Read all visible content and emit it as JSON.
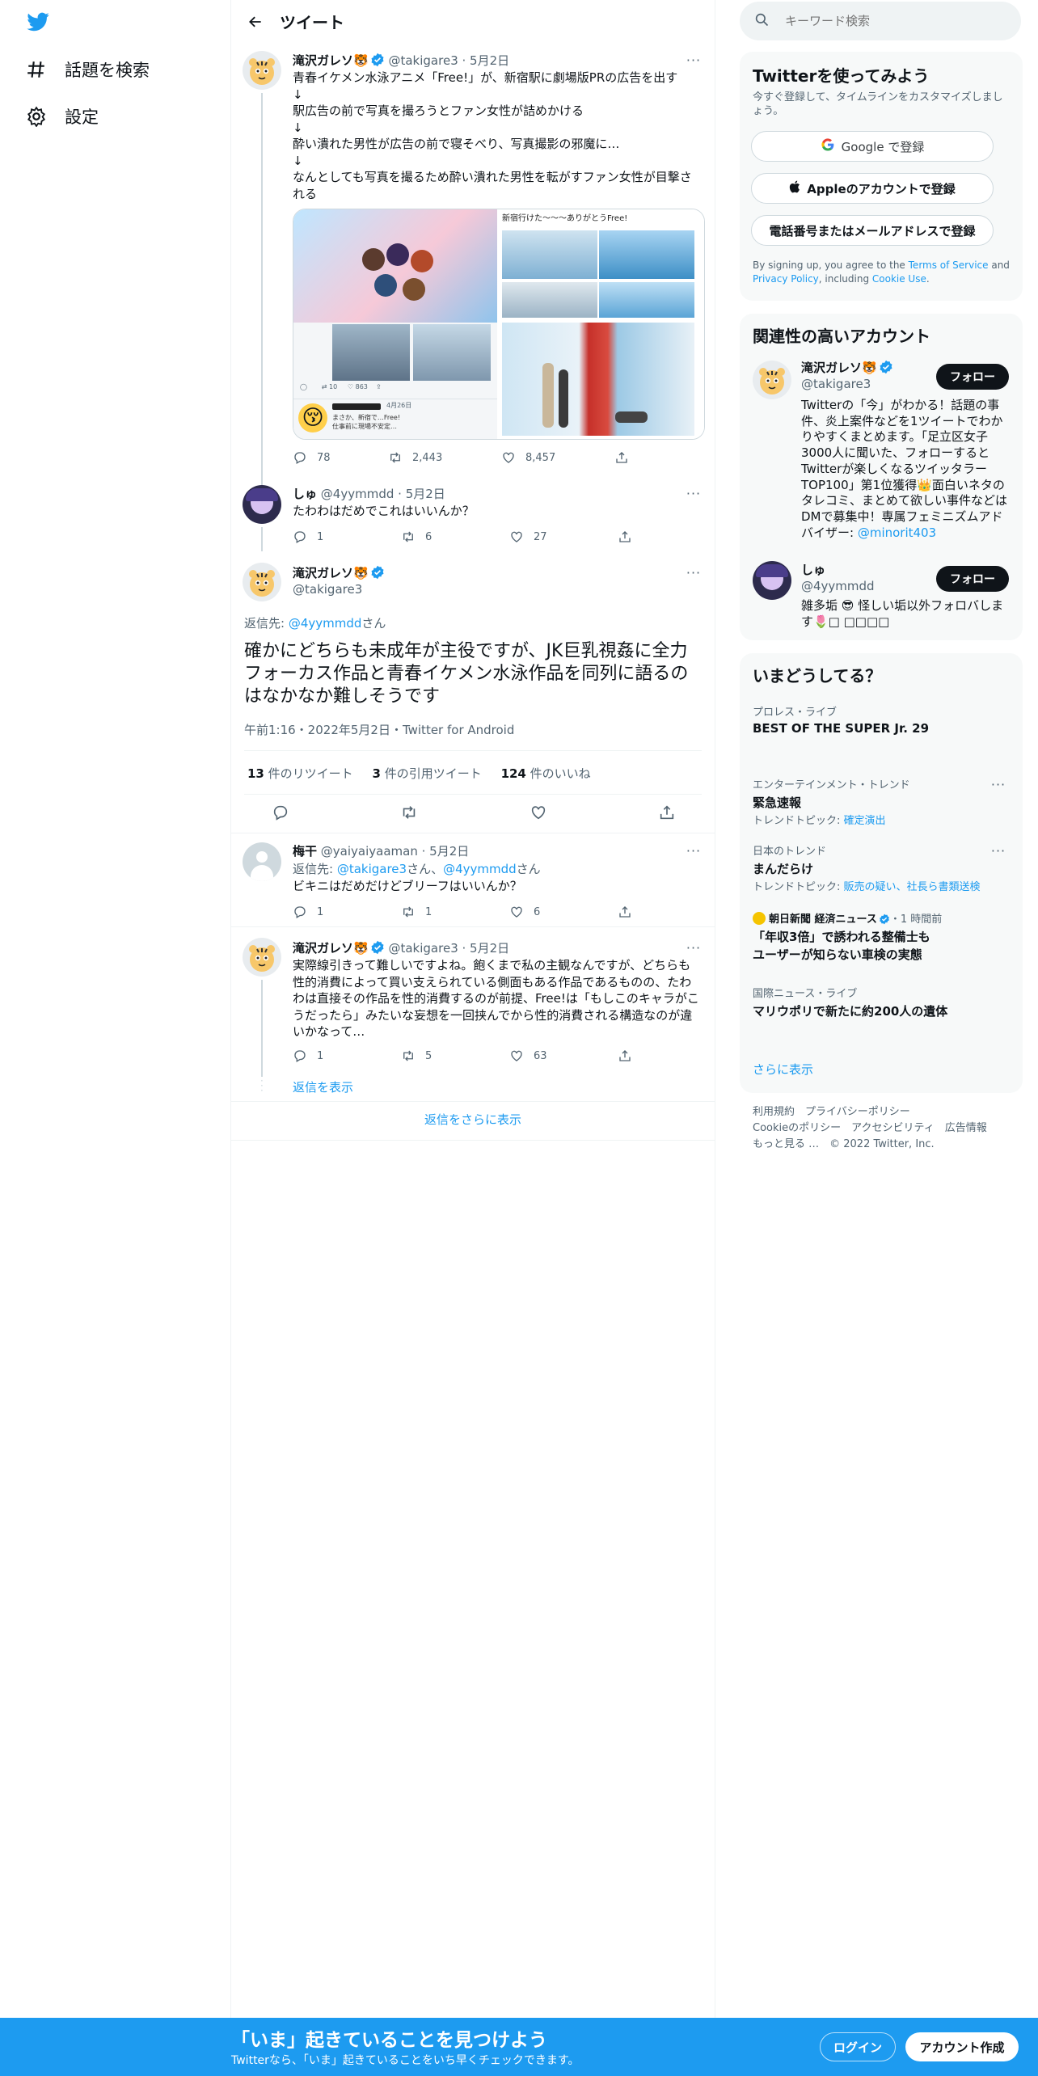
{
  "nav": {
    "explore": "話題を検索",
    "settings": "設定"
  },
  "header": {
    "title": "ツイート"
  },
  "parent_tweet": {
    "name": "滝沢ガレソ",
    "emoji": "🐯",
    "handle": "@takigare3",
    "date": "5月2日",
    "lines": [
      "青春イケメン水泳アニメ「Free!」が、新宿駅に劇場版PRの広告を出す",
      "↓",
      "駅広告の前で写真を撮ろうとファン女性が詰めかける",
      "↓",
      "酔い潰れた男性が広告の前で寝そべり、写真撮影の邪魔に…",
      "↓",
      "なんとしても写真を撮るため酔い潰れた男性を転がすファン女性が目撃さ",
      "れる"
    ],
    "image_banner": "新宿行けた〜〜〜ありがとうFree!",
    "embedded_date": "4月26日",
    "embedded_text1": "まさか、新宿で…Free!",
    "embedded_text2": "仕事前に現場不安定…",
    "replies": "78",
    "retweets": "2,443",
    "likes": "8,457"
  },
  "reply_shu": {
    "name": "しゅ",
    "handle": "@4yymmdd",
    "date": "5月2日",
    "text": "たわわはだめでこれはいいんか？",
    "replies": "1",
    "retweets": "6",
    "likes": "27"
  },
  "main_tweet": {
    "name": "滝沢ガレソ",
    "emoji": "🐯",
    "handle": "@takigare3",
    "reply_prefix": "返信先: ",
    "reply_to": "@4yymmdd",
    "reply_suffix": "さん",
    "text": "確かにどちらも未成年が主役ですが、JK巨乳視姦に全力フォーカス作品と青春イケメン水泳作品を同列に語るのはなかなか難しそうです",
    "timestamp": "午前1:16・2022年5月2日・Twitter for Android",
    "retweet_count": "13",
    "retweet_label": " 件のリツイート",
    "quote_count": "3",
    "quote_label": " 件の引用ツイート",
    "like_count": "124",
    "like_label": " 件のいいね"
  },
  "reply_umeboshi": {
    "name": "梅干",
    "handle": "@yaiyaiyaaman",
    "date": "5月2日",
    "reply_prefix": "返信先: ",
    "reply_to1": "@takigare3",
    "mid": "さん、",
    "reply_to2": "@4yymmdd",
    "reply_suffix": "さん",
    "text": "ビキニはだめだけどブリーフはいいんか？",
    "replies": "1",
    "retweets": "1",
    "likes": "6"
  },
  "reply_garesso": {
    "name": "滝沢ガレソ",
    "emoji": "🐯",
    "handle": "@takigare3",
    "date": "5月2日",
    "lines": [
      "実際線引きって難しいですよね。飽くまで私の主観なんですが、どちらも",
      "性的消費によって買い支えられている側面もある作品であるものの、たわ",
      "わは直接その作品を性的消費するのが前提、Free!は「もしこのキャラがこ",
      "うだったら」みたいな妄想を一回挟んでから性的消費される構造なのが違",
      "いかなって…"
    ],
    "replies": "1",
    "retweets": "5",
    "likes": "63",
    "show_replies": "返信を表示"
  },
  "more_replies": "返信をさらに表示",
  "search": {
    "placeholder": "キーワード検索"
  },
  "signup_card": {
    "title": "Twitterを使ってみよう",
    "subtitle1": "今すぐ登録して、タイムラインをカスタマイズしまし",
    "subtitle2": "ょう。",
    "google": "Google で登録",
    "apple": "Appleのアカウントで登録",
    "phone": "電話番号またはメールアドレスで登録",
    "terms1": "By signing up, you agree to the ",
    "tos": "Terms of Service",
    "and": " and",
    "privacy": "Privacy Policy",
    "including": ", including ",
    "cookie": "Cookie Use",
    "dot": "."
  },
  "relevant": {
    "title": "関連性の高いアカウント",
    "follow_label": "フォロー",
    "accounts": [
      {
        "name": "滝沢ガレソ🐯",
        "handle": "@takigare3",
        "bio": [
          "Twitterの「今」がわかる！話題の事",
          "件、炎上案件などを1ツイートでわか",
          "りやすくまとめます。「足立区女子",
          "3000人に聞いた、フォローすると",
          "Twitterが楽しくなるツイッタラー",
          "TOP100」第1位獲得👑面白いネタの",
          "タレコミ、まとめて欲しい事件などは",
          "DMで募集中！専属フェミニズムアド",
          "バイザー: "
        ],
        "bio_link": "@minorit403"
      },
      {
        "name": "しゅ",
        "handle": "@4yymmdd",
        "bio": [
          "雑多垢 😎 怪しい垢以外フォロバしま",
          "す🌷□ □□□□"
        ]
      }
    ]
  },
  "trends": {
    "title": "いまどうしてる？",
    "items": [
      {
        "category": "プロレス・ライブ",
        "name": "BEST OF THE SUPER Jr. 29"
      },
      {
        "category": "エンターテインメント・トレンド",
        "name": "緊急速報",
        "sub_prefix": "トレンドトピック: ",
        "sub": "確定演出"
      },
      {
        "category": "日本のトレンド",
        "name": "まんだらけ",
        "sub_prefix": "トレンドトピック: ",
        "sub": "販売の疑い、社長ら書類送検"
      },
      {
        "category": "朝日新聞 経済ニュース",
        "time": "・1 時間前",
        "name": "「年収3倍」で誘われる整備士も",
        "name2": "ユーザーが知らない車検の実態"
      },
      {
        "category": "国際ニュース・ライブ",
        "name": "マリウポリで新たに約200人の遺体"
      }
    ],
    "show_more": "さらに表示"
  },
  "footer": {
    "line1": "利用規約　プライバシーポリシー",
    "line2": "Cookieのポリシー　アクセシビリティ　広告情報",
    "line3": "もっと見る …　© 2022 Twitter, Inc."
  },
  "bottom": {
    "title": "「いま」起きていることを見つけよう",
    "subtitle": "Twitterなら、「いま」起きていることをいち早くチェックできます。",
    "login": "ログイン",
    "signup": "アカウント作成"
  },
  "colors": {
    "accent": "#1d9bf0",
    "text": "#0f1419",
    "gray": "#536471"
  }
}
